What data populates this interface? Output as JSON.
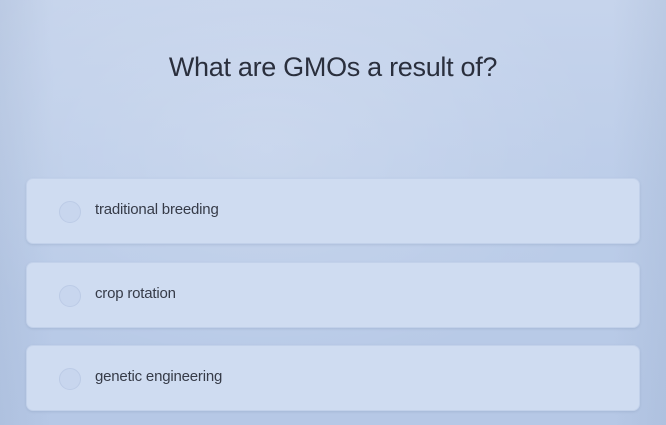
{
  "question": {
    "text": "What are GMOs a result of?"
  },
  "options": [
    {
      "label": "traditional breeding"
    },
    {
      "label": "crop rotation"
    },
    {
      "label": "genetic engineering"
    }
  ],
  "colors": {
    "background": "#bccde9",
    "option_card": "#cfdcf1",
    "text": "#2a2f3d"
  }
}
